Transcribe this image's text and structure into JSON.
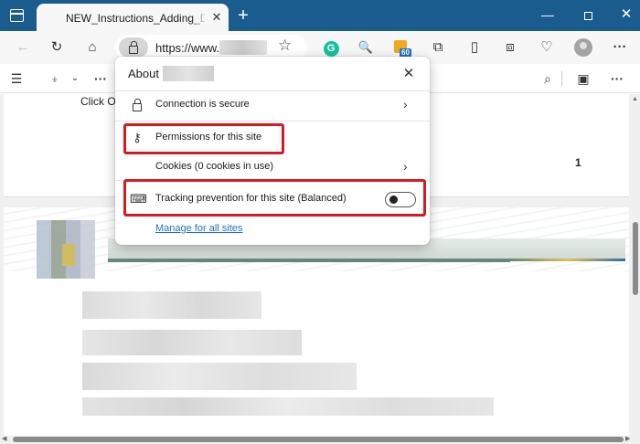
{
  "window": {
    "tab_title": "NEW_Instructions_Adding_DISS_",
    "tab_close": "✕",
    "new_tab": "+",
    "minimize": "—",
    "close": "✕",
    "titlebar_color": "#1b5c8f"
  },
  "navbar": {
    "back_icon": "←",
    "refresh_icon": "↻",
    "home_icon": "⌂",
    "url": "https://www.",
    "favorite_icon": "☆",
    "grammarly": "G",
    "key_icon": "🔍",
    "rss_badge": "60",
    "extensions_icon": "⧉",
    "split_icon": "▯",
    "collections_icon": "⧈",
    "health_icon": "♡",
    "more": "···"
  },
  "toolbar": {
    "contents_icon": "☰",
    "highlight_icon": "⍖",
    "chevron": "⌄",
    "more": "···",
    "search_icon": "⌕",
    "save_icon": "▣",
    "more_right": "···"
  },
  "document": {
    "click_text": "Click O",
    "page_number": "1"
  },
  "popup": {
    "title": "About",
    "close_icon": "✕",
    "rows": [
      {
        "label": "Connection is secure",
        "icon": "lock-icon",
        "chevron": "›"
      },
      {
        "label": "Permissions for this site",
        "icon": "key-icon",
        "glyph": "⚷"
      },
      {
        "label": "Cookies (0 cookies in use)",
        "chevron": "›"
      },
      {
        "label": "Tracking prevention for this site (Balanced)",
        "icon": "tracking-icon",
        "glyph": "⌨"
      }
    ],
    "tracking_toggle_on": false,
    "manage_link": "Manage for all sites"
  },
  "colors": {
    "highlight": "#d51b22",
    "link": "#1f6fd0"
  }
}
